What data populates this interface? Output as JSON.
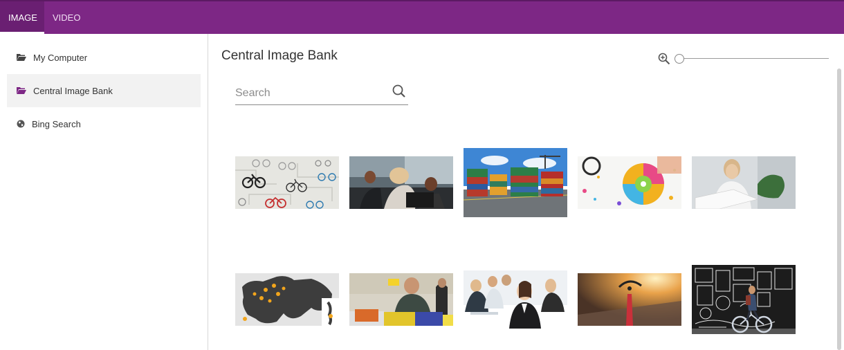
{
  "tabs": [
    {
      "label": "IMAGE",
      "active": true
    },
    {
      "label": "VIDEO",
      "active": false
    }
  ],
  "sidebar": {
    "items": [
      {
        "label": "My Computer",
        "icon": "folder-open-icon"
      },
      {
        "label": "Central Image Bank",
        "icon": "folder-open-icon",
        "active": true
      },
      {
        "label": "Bing Search",
        "icon": "globe-icon"
      }
    ]
  },
  "main": {
    "title": "Central Image Bank",
    "search": {
      "placeholder": "Search",
      "value": ""
    },
    "zoom_level": 0,
    "images": [
      {
        "name": "image-bicycles-pattern"
      },
      {
        "name": "image-office-team"
      },
      {
        "name": "image-shipping-containers"
      },
      {
        "name": "image-bike-spin-art"
      },
      {
        "name": "image-woman-with-papers"
      },
      {
        "name": "image-europe-map"
      },
      {
        "name": "image-worker-with-bins"
      },
      {
        "name": "image-business-meeting"
      },
      {
        "name": "image-cycling-sunset"
      },
      {
        "name": "image-cyclist-mural"
      }
    ]
  },
  "colors": {
    "accent": "#7d2785",
    "accent_dark": "#6a1f72",
    "active_item_bg": "#f2f2f2"
  }
}
